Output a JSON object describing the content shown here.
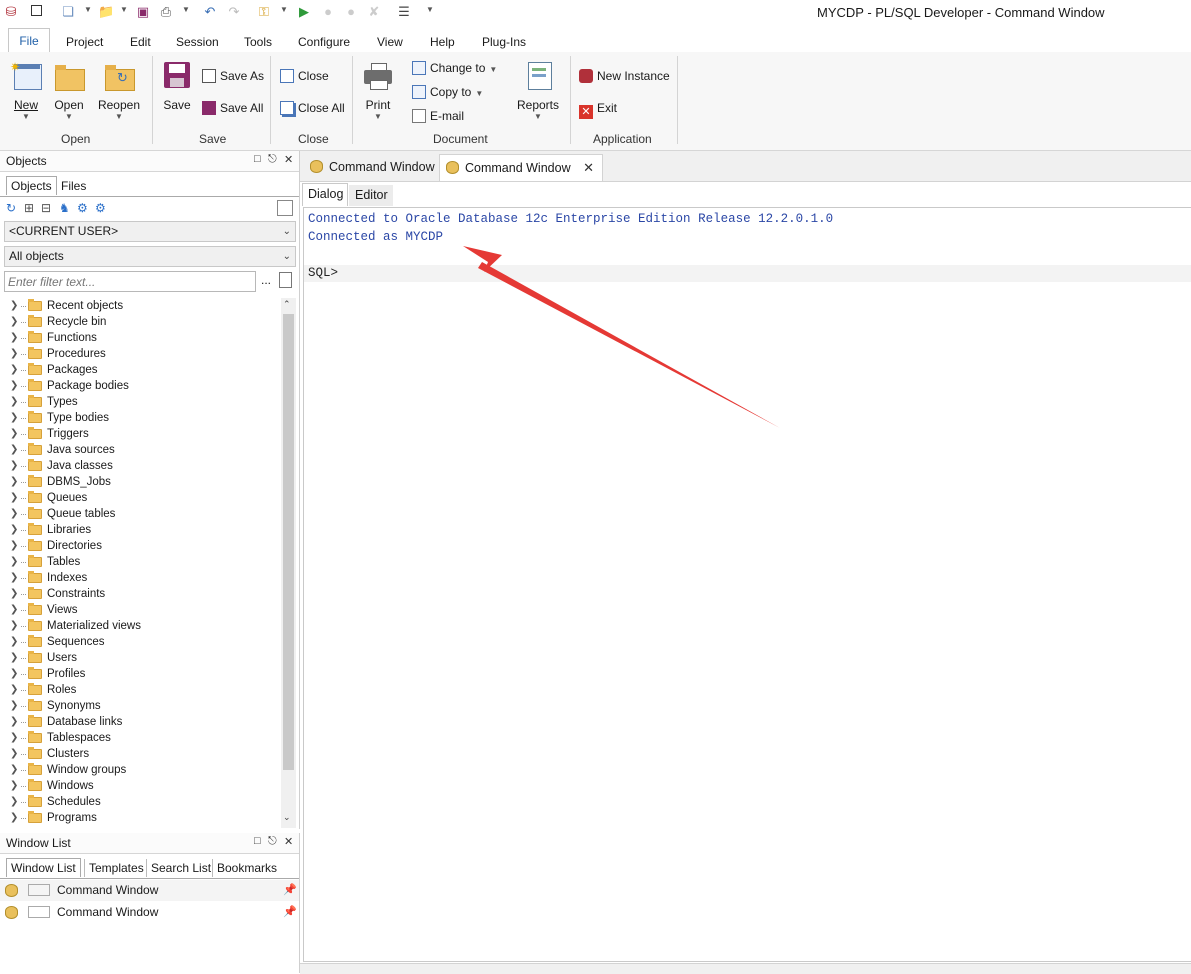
{
  "window": {
    "title": "MYCDP - PL/SQL Developer - Command Window"
  },
  "menu": {
    "tabs": [
      "File",
      "Project",
      "Edit",
      "Session",
      "Tools",
      "Configure",
      "View",
      "Help",
      "Plug-Ins"
    ]
  },
  "ribbon": {
    "open_group": {
      "label": "Open",
      "new": "New",
      "open": "Open",
      "reopen": "Reopen"
    },
    "save_group": {
      "label": "Save",
      "save": "Save",
      "save_as": "Save As",
      "save_all": "Save All"
    },
    "close_group": {
      "label": "Close",
      "close": "Close",
      "close_all": "Close All"
    },
    "document_group": {
      "label": "Document",
      "print": "Print",
      "change_to": "Change to",
      "copy_to": "Copy to",
      "email": "E-mail",
      "reports": "Reports"
    },
    "application_group": {
      "label": "Application",
      "new_instance": "New Instance",
      "exit": "Exit"
    }
  },
  "objects_panel": {
    "title": "Objects",
    "tabs": [
      "Objects",
      "Files"
    ],
    "user_select": "<CURRENT USER>",
    "filter_select": "All objects",
    "filter_placeholder": "Enter filter text...",
    "tree_items": [
      "Recent objects",
      "Recycle bin",
      "Functions",
      "Procedures",
      "Packages",
      "Package bodies",
      "Types",
      "Type bodies",
      "Triggers",
      "Java sources",
      "Java classes",
      "DBMS_Jobs",
      "Queues",
      "Queue tables",
      "Libraries",
      "Directories",
      "Tables",
      "Indexes",
      "Constraints",
      "Views",
      "Materialized views",
      "Sequences",
      "Users",
      "Profiles",
      "Roles",
      "Synonyms",
      "Database links",
      "Tablespaces",
      "Clusters",
      "Window groups",
      "Windows",
      "Schedules",
      "Programs"
    ]
  },
  "window_list": {
    "title": "Window List",
    "tabs": [
      "Window List",
      "Templates",
      "Search List",
      "Bookmarks"
    ],
    "items": [
      "Command Window",
      "Command Window"
    ]
  },
  "document": {
    "tabs": [
      "Command Window",
      "Command Window"
    ],
    "subtabs": [
      "Dialog",
      "Editor"
    ],
    "output": [
      "Connected to Oracle Database 12c Enterprise Edition Release 12.2.0.1.0",
      "Connected as MYCDP"
    ],
    "prompt": "SQL>"
  },
  "colors": {
    "output_text": "#2b47a6",
    "annotation_arrow": "#e53935",
    "folder": "#f3c55f"
  }
}
